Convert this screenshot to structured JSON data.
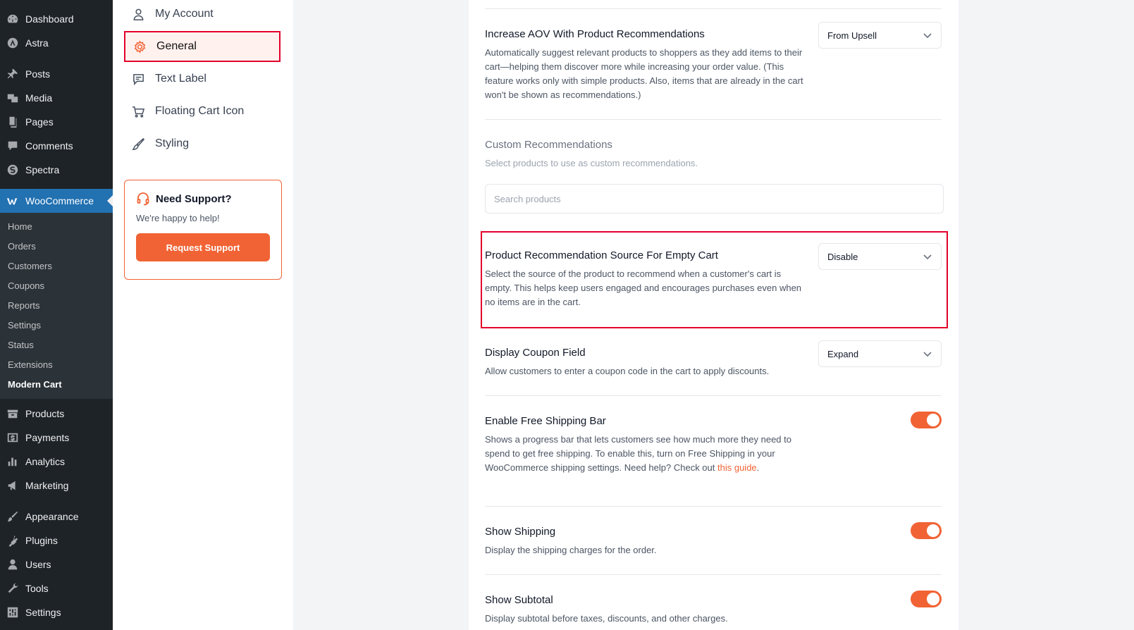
{
  "wp_menu": {
    "items_top": [
      {
        "label": "Dashboard",
        "icon": "dashboard-icon"
      },
      {
        "label": "Astra",
        "icon": "astra-icon"
      }
    ],
    "items_content": [
      {
        "label": "Posts",
        "icon": "pin-icon"
      },
      {
        "label": "Media",
        "icon": "media-icon"
      },
      {
        "label": "Pages",
        "icon": "pages-icon"
      },
      {
        "label": "Comments",
        "icon": "comment-icon"
      },
      {
        "label": "Spectra",
        "icon": "spectra-icon"
      }
    ],
    "woocommerce": {
      "label": "WooCommerce",
      "icon": "woocommerce-icon",
      "submenu": [
        "Home",
        "Orders",
        "Customers",
        "Coupons",
        "Reports",
        "Settings",
        "Status",
        "Extensions",
        "Modern Cart"
      ],
      "current": "Modern Cart"
    },
    "items_store": [
      {
        "label": "Products",
        "icon": "products-icon"
      },
      {
        "label": "Payments",
        "icon": "payments-icon"
      },
      {
        "label": "Analytics",
        "icon": "analytics-icon"
      },
      {
        "label": "Marketing",
        "icon": "marketing-icon"
      }
    ],
    "items_admin": [
      {
        "label": "Appearance",
        "icon": "brush-icon"
      },
      {
        "label": "Plugins",
        "icon": "plugin-icon"
      },
      {
        "label": "Users",
        "icon": "user-icon"
      },
      {
        "label": "Tools",
        "icon": "wrench-icon"
      },
      {
        "label": "Settings",
        "icon": "settings-icon"
      }
    ]
  },
  "plugin_nav": {
    "items": [
      {
        "label": "My Account",
        "icon": "user-outline-icon"
      },
      {
        "label": "General",
        "icon": "gear-icon",
        "selected": true
      },
      {
        "label": "Text Label",
        "icon": "message-icon"
      },
      {
        "label": "Floating Cart Icon",
        "icon": "cart-icon"
      },
      {
        "label": "Styling",
        "icon": "brush-outline-icon"
      }
    ],
    "support": {
      "title": "Need Support?",
      "text": "We're happy to help!",
      "button": "Request Support",
      "icon": "headset-icon"
    }
  },
  "settings": {
    "aov": {
      "title": "Increase AOV With Product Recommendations",
      "desc": "Automatically suggest relevant products to shoppers as they add items to their cart—helping them discover more while increasing your order value. (This feature works only with simple products. Also, items that are already in the cart won't be shown as recommendations.)",
      "value": "From Upsell"
    },
    "custom_reco": {
      "title": "Custom Recommendations",
      "desc": "Select products to use as custom recommendations.",
      "placeholder": "Search products"
    },
    "empty_cart": {
      "title": "Product Recommendation Source For Empty Cart",
      "desc": "Select the source of the product to recommend when a customer's cart is empty. This helps keep users engaged and encourages purchases even when no items are in the cart.",
      "value": "Disable"
    },
    "coupon": {
      "title": "Display Coupon Field",
      "desc": "Allow customers to enter a coupon code in the cart to apply discounts.",
      "value": "Expand"
    },
    "free_shipping": {
      "title": "Enable Free Shipping Bar",
      "desc": "Shows a progress bar that lets customers see how much more they need to spend to get free shipping. To enable this, turn on Free Shipping in your WooCommerce shipping settings. Need help? Check out ",
      "link": "this guide",
      "after": ".",
      "enabled": true
    },
    "show_shipping": {
      "title": "Show Shipping",
      "desc": "Display the shipping charges for the order.",
      "enabled": true
    },
    "show_subtotal": {
      "title": "Show Subtotal",
      "desc": "Display subtotal before taxes, discounts, and other charges.",
      "enabled": true
    }
  },
  "colors": {
    "accent": "#f16334",
    "highlight": "#e3002b",
    "wp_menu_bg": "#1d2327",
    "wp_active": "#2271b1"
  }
}
